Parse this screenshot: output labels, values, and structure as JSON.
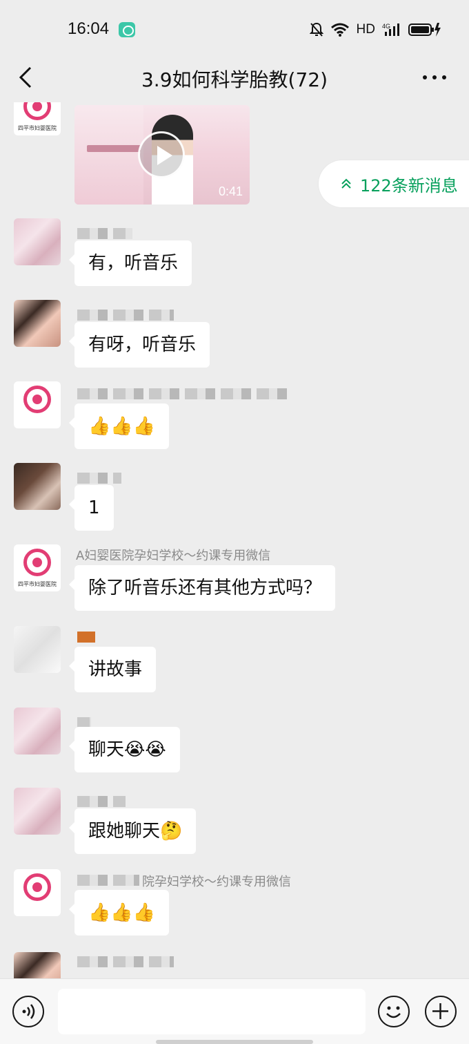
{
  "status_bar": {
    "time": "16:04",
    "network": "HD",
    "cell_type": "4G",
    "icons": [
      "app-notification-icon",
      "mute-bell-icon",
      "wifi-icon",
      "signal-icon",
      "battery-charging-icon"
    ]
  },
  "header": {
    "title": "3.9如何科学胎教(72)",
    "back_icon": "chevron-left-icon",
    "more_icon": "more-dots-icon"
  },
  "new_messages": {
    "label": "122条新消息",
    "icon": "double-chevron-up-icon",
    "color": "#07a05c"
  },
  "video": {
    "duration": "0:41"
  },
  "messages": [
    {
      "sender": "",
      "text": "有，听音乐"
    },
    {
      "sender": "",
      "text": "有呀，听音乐"
    },
    {
      "sender": "",
      "text": "👍👍👍"
    },
    {
      "sender": "",
      "text": "1"
    },
    {
      "sender": "A妇婴医院孕妇学校～约课专用微信",
      "text": "除了听音乐还有其他方式吗？"
    },
    {
      "sender": "",
      "text": "讲故事"
    },
    {
      "sender": "",
      "text": "聊天😭😭"
    },
    {
      "sender": "",
      "text": "跟她聊天🤔"
    },
    {
      "sender": "院孕妇学校～约课专用微信",
      "text": "👍👍👍"
    }
  ],
  "logo_avatar_text": "四平市妇婴医院",
  "input_bar": {
    "placeholder": "",
    "voice_icon": "voice-icon",
    "emoji_icon": "emoji-icon",
    "plus_icon": "plus-icon"
  },
  "colors": {
    "background": "#ededed",
    "bubble": "#ffffff",
    "accent": "#07a05c",
    "logo": "#e23d74"
  }
}
